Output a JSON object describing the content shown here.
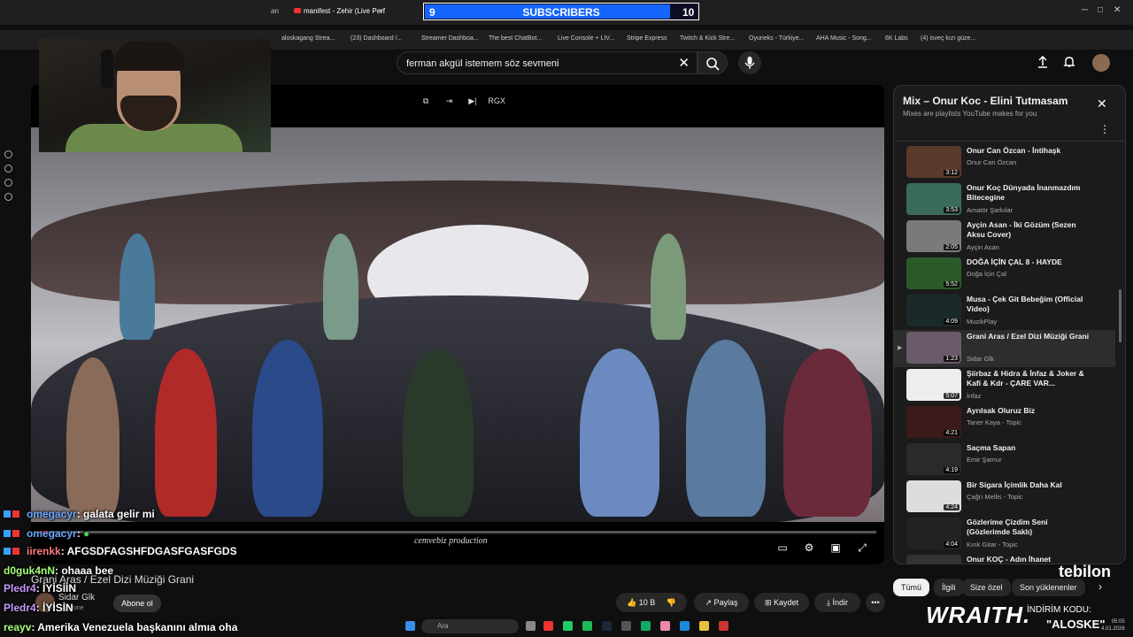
{
  "browser": {
    "tabs": [
      {
        "label": "an"
      },
      {
        "label": "manifest - Zehir (Live Perf"
      }
    ],
    "new_tab": "+",
    "bookmarks": [
      "aloskagang Strea...",
      "(23) Dashboard /...",
      "Streamer Dashboa...",
      "The best ChatBot...",
      "Live Console + LIV...",
      "Stripe Express",
      "Twitch & Kick Stre...",
      "Oyuneks - Türkiye...",
      "AHA Music - Song...",
      "6K Labs",
      "(4) isveç kızı güze..."
    ]
  },
  "subscriber_goal": {
    "current": "9",
    "label": "SUBSCRIBERS",
    "target": "10",
    "progress": 0.9
  },
  "youtube": {
    "search_value": "ferman akgül istemem söz sevmeni",
    "clear_icon": "✕",
    "overlay_label": "RGX"
  },
  "video": {
    "title": "Grani Aras / Ezel Dizi Müziği Grani",
    "channel": "Sidar Glk",
    "subscribers": "11 abone",
    "subscribe_label": "Abone ol",
    "watermark": "cemvebiz production",
    "progress": 0.008
  },
  "actions": {
    "like_count": "10 B",
    "share": "Paylaş",
    "save": "Kaydet",
    "download": "İndir",
    "more": "•••"
  },
  "playlist": {
    "title": "Mix – Onur Koc - Elini Tutmasam",
    "subtitle": "Mixes are playlists YouTube makes for you",
    "items": [
      {
        "title": "Onur Can Özcan - İntihaşk",
        "channel": "Onur Can Özcan",
        "duration": "3:12",
        "color": "#5a3a2a"
      },
      {
        "title": "Onur Koç Dünyada İnanmazdım Bitecegine",
        "channel": "Amatör Şarkılar",
        "duration": "3:53",
        "color": "#3a6a5a"
      },
      {
        "title": "Ayçin Asan - İki Gözüm (Sezen Aksu Cover)",
        "channel": "Ayçin Asan",
        "duration": "2:05",
        "color": "#7a7a7a"
      },
      {
        "title": "DOĞA İÇİN ÇAL 8 - HAYDE",
        "channel": "Doğa İçin Çal",
        "duration": "5:52",
        "color": "#2a5a2a"
      },
      {
        "title": "Musa - Çek Git Bebeğim (Official Video)",
        "channel": "MuzikPlay",
        "duration": "4:09",
        "color": "#1a2a2a"
      },
      {
        "title": "Grani Aras / Ezel Dizi Müziği Grani",
        "channel": "Sidar Glk",
        "duration": "1:23",
        "color": "#6a5a6a"
      },
      {
        "title": "Şiirbaz & Hidra & İnfaz & Joker & Kafi & Kdr - ÇARE VAR...",
        "channel": "İnfaz",
        "duration": "5:07",
        "color": "#eeeeee"
      },
      {
        "title": "Ayrılsak Oluruz Biz",
        "channel": "Taner Kaya - Topic",
        "duration": "4:21",
        "color": "#3a1a1a"
      },
      {
        "title": "Saçma Sapan",
        "channel": "Emir Şamur",
        "duration": "4:19",
        "color": "#2a2a2a"
      },
      {
        "title": "Bir Sigara İçimlik Daha Kal",
        "channel": "Çağrı Mellis - Topic",
        "duration": "4:24",
        "color": "#dddddd"
      },
      {
        "title": "Gözlerime Çizdim Seni (Gözlerimde Saklı)",
        "channel": "Kırık Gitar - Topic",
        "duration": "4:04",
        "color": "#222222"
      },
      {
        "title": "Onur KOÇ - Adın İhanet",
        "channel": "",
        "duration": "",
        "color": "#333333"
      }
    ]
  },
  "chips": [
    "Tümü",
    "İlgili",
    "Size özel",
    "Son yüklenenler"
  ],
  "chat": [
    {
      "user": "omegacyr",
      "text": ": galata gelir mi"
    },
    {
      "user": "omegacyr",
      "text": ": "
    },
    {
      "user": "iirenkk",
      "text": ": AFGSDFAGSHFDGASFGASFGDS"
    },
    {
      "user": "d0guk4nN",
      "text": ": ohaaa bee"
    },
    {
      "user": "Pledr4",
      "text": ": İYİSİİN"
    },
    {
      "user": "Pledr4",
      "text": ": İYİSİN"
    },
    {
      "user": "reayv",
      "text": ": Amerika Venezuela başkanını almıa oha"
    }
  ],
  "taskbar": {
    "search": "Ara"
  },
  "stream": {
    "brand": "WRAITH.",
    "promo_line1": "İNDİRİM KODU:",
    "promo_code": "\"ALOSKE\"",
    "sponsor": "tebilon",
    "clock_time": "05:05",
    "clock_date": "4.01.2026"
  }
}
